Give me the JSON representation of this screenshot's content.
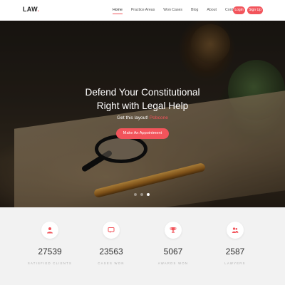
{
  "header": {
    "logo": "LAW",
    "logo_dot": ".",
    "nav": [
      {
        "label": "Home",
        "active": true
      },
      {
        "label": "Practice Areas",
        "active": false
      },
      {
        "label": "Won Cases",
        "active": false
      },
      {
        "label": "Blog",
        "active": false
      },
      {
        "label": "About",
        "active": false
      },
      {
        "label": "Contact",
        "active": false
      }
    ],
    "login_label": "Login",
    "signup_label": "Sign Up"
  },
  "hero": {
    "title_line1": "Defend Your Constitutional",
    "title_line2": "Right with Legal Help",
    "subtitle_prefix": "Get this layout!",
    "subtitle_link": "Pobcone",
    "cta_label": "Make An Appointment",
    "slides": 3,
    "active_slide": 3
  },
  "stats": [
    {
      "icon": "user-icon",
      "value": "27539",
      "label": "SATISFIED CLIENTS"
    },
    {
      "icon": "chat-icon",
      "value": "23563",
      "label": "CASES WON"
    },
    {
      "icon": "trophy-icon",
      "value": "5067",
      "label": "AWARDS WON"
    },
    {
      "icon": "lawyers-icon",
      "value": "2587",
      "label": "LAWYERS"
    }
  ],
  "colors": {
    "accent": "#f2545b",
    "stats_bg": "#f2f2f2"
  }
}
